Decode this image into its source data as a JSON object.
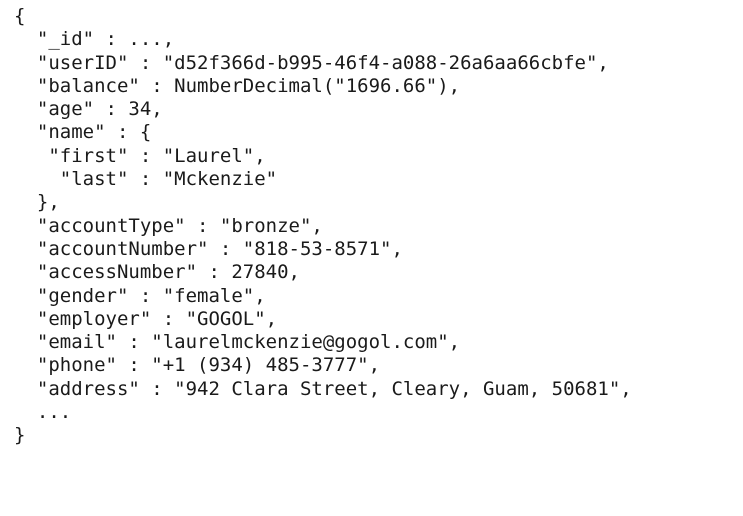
{
  "document": {
    "lines": [
      "{",
      "  \"_id\" : ...,",
      "  \"userID\" : \"d52f366d-b995-46f4-a088-26a6aa66cbfe\",",
      "  \"balance\" : NumberDecimal(\"1696.66\"),",
      "  \"age\" : 34,",
      "  \"name\" : {",
      "   \"first\" : \"Laurel\",",
      "    \"last\" : \"Mckenzie\"",
      "  },",
      "  \"accountType\" : \"bronze\",",
      "  \"accountNumber\" : \"818-53-8571\",",
      "  \"accessNumber\" : 27840,",
      "  \"gender\" : \"female\",",
      "  \"employer\" : \"GOGOL\",",
      "  \"email\" : \"laurelmckenzie@gogol.com\",",
      "  \"phone\" : \"+1 (934) 485-3777\",",
      "  \"address\" : \"942 Clara Street, Cleary, Guam, 50681\",",
      "  ...",
      "}"
    ]
  }
}
